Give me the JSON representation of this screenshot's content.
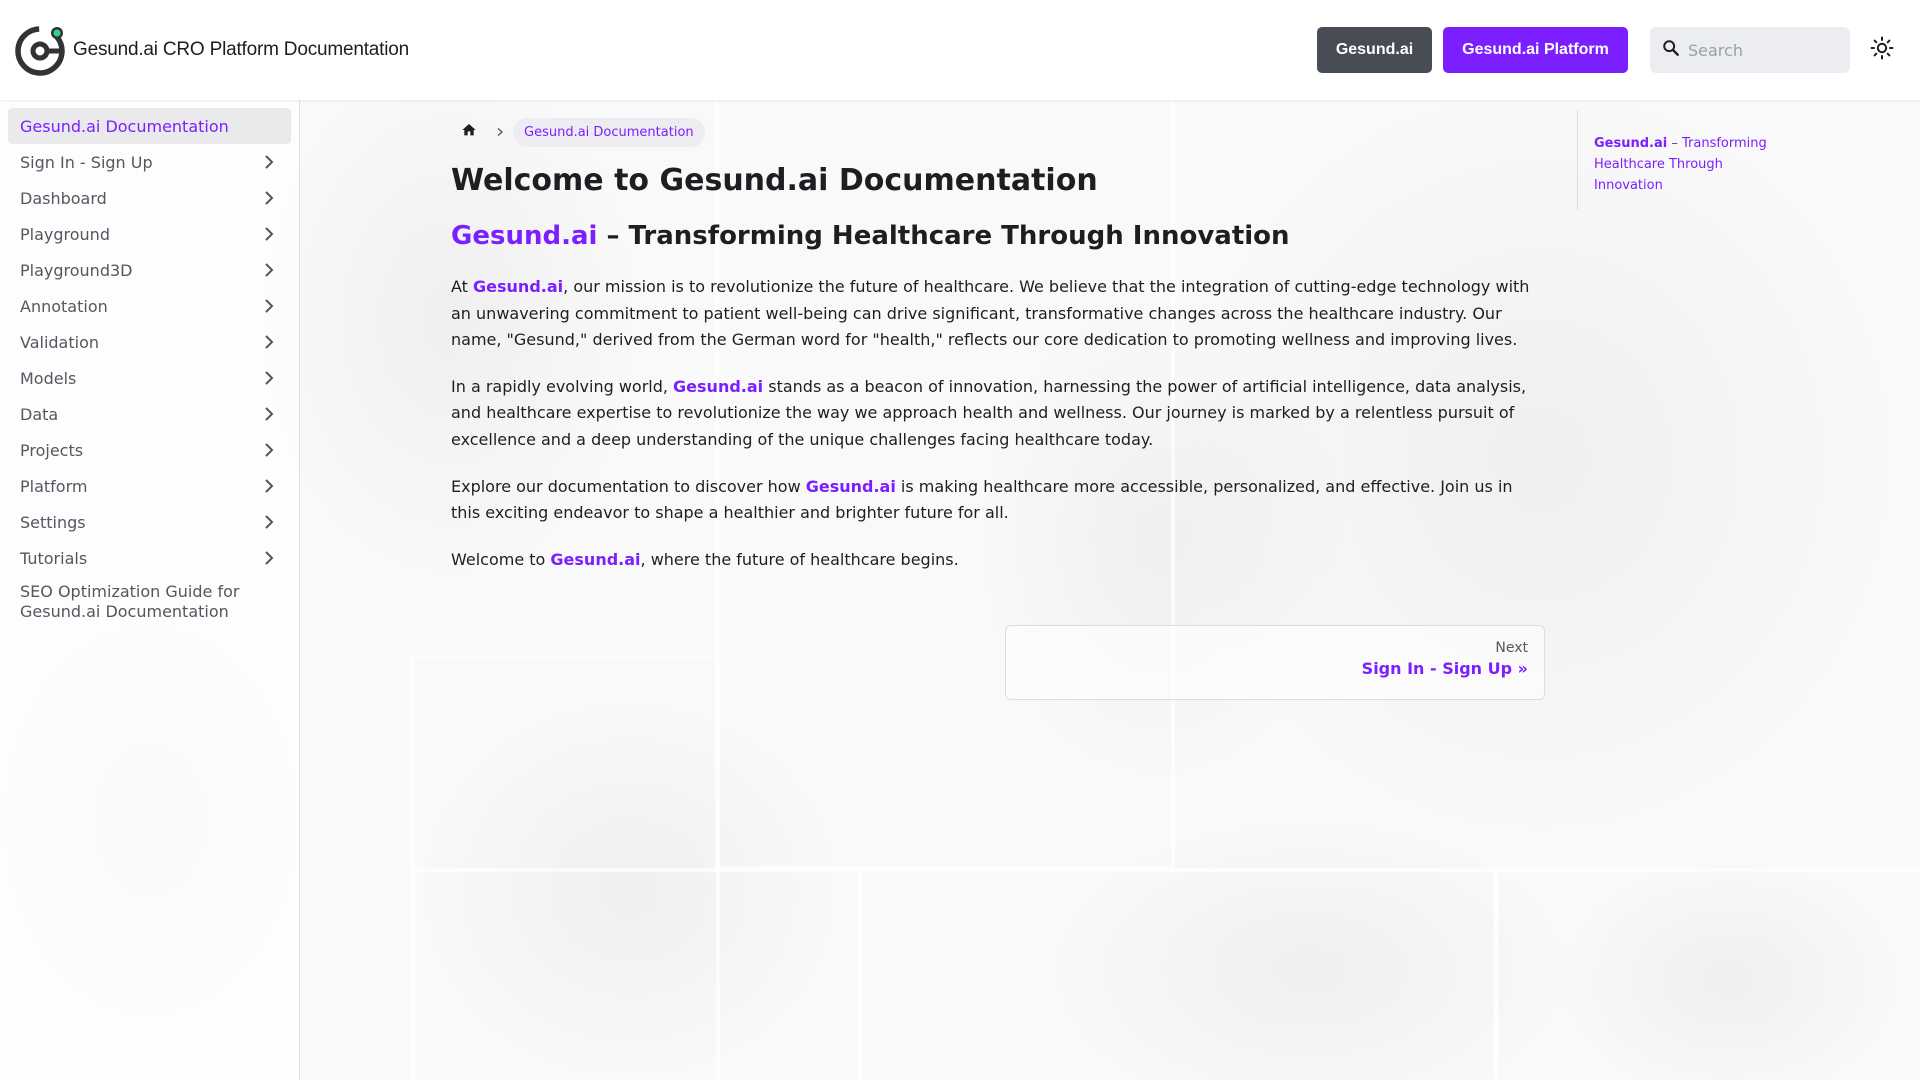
{
  "navbar": {
    "title": "Gesund.ai CRO Platform Documentation",
    "btn_gesund": "Gesund.ai",
    "btn_platform": "Gesund.ai Platform",
    "search_placeholder": "Search",
    "accent": "#7b1fff",
    "dark_button": "#474c55",
    "logo_accent": "#2fd38a"
  },
  "sidebar": {
    "items": [
      {
        "label": "Gesund.ai Documentation",
        "active": true
      },
      {
        "label": "Sign In - Sign Up"
      },
      {
        "label": "Dashboard"
      },
      {
        "label": "Playground"
      },
      {
        "label": "Playground3D"
      },
      {
        "label": "Annotation"
      },
      {
        "label": "Validation"
      },
      {
        "label": "Models"
      },
      {
        "label": "Data"
      },
      {
        "label": "Projects"
      },
      {
        "label": "Platform"
      },
      {
        "label": "Settings"
      },
      {
        "label": "Tutorials"
      },
      {
        "label": "SEO Optimization Guide for Gesund.ai Documentation"
      }
    ]
  },
  "breadcrumb": {
    "current": "Gesund.ai Documentation"
  },
  "content": {
    "h1": "Welcome to Gesund.ai Documentation",
    "h2_brand": "Gesund.ai",
    "h2_rest": " – Transforming Healthcare Through Innovation",
    "p1": [
      "At ",
      "Gesund.ai",
      ", our mission is to revolutionize the future of healthcare. We believe that the integration of cutting-edge technology with an unwavering commitment to patient well-being can drive significant, transformative changes across the healthcare industry. Our name, \"Gesund,\" derived from the German word for \"health,\" reflects our core dedication to promoting wellness and improving lives."
    ],
    "p2": [
      "In a rapidly evolving world, ",
      "Gesund.ai",
      " stands as a beacon of innovation, harnessing the power of artificial intelligence, data analysis, and healthcare expertise to revolutionize the way we approach health and wellness. Our journey is marked by a relentless pursuit of excellence and a deep understanding of the unique challenges facing healthcare today."
    ],
    "p3": [
      "Explore our documentation to discover how ",
      "Gesund.ai",
      " is making healthcare more accessible, personalized, and effective. Join us in this exciting endeavor to shape a healthier and brighter future for all."
    ],
    "p4": [
      "Welcome to ",
      "Gesund.ai",
      ", where the future of healthcare begins."
    ]
  },
  "pagination": {
    "sub": "Next",
    "label": "Sign In - Sign Up »"
  },
  "toc": {
    "brand": "Gesund.ai",
    "rest": " – Transforming Healthcare Through Innovation"
  }
}
